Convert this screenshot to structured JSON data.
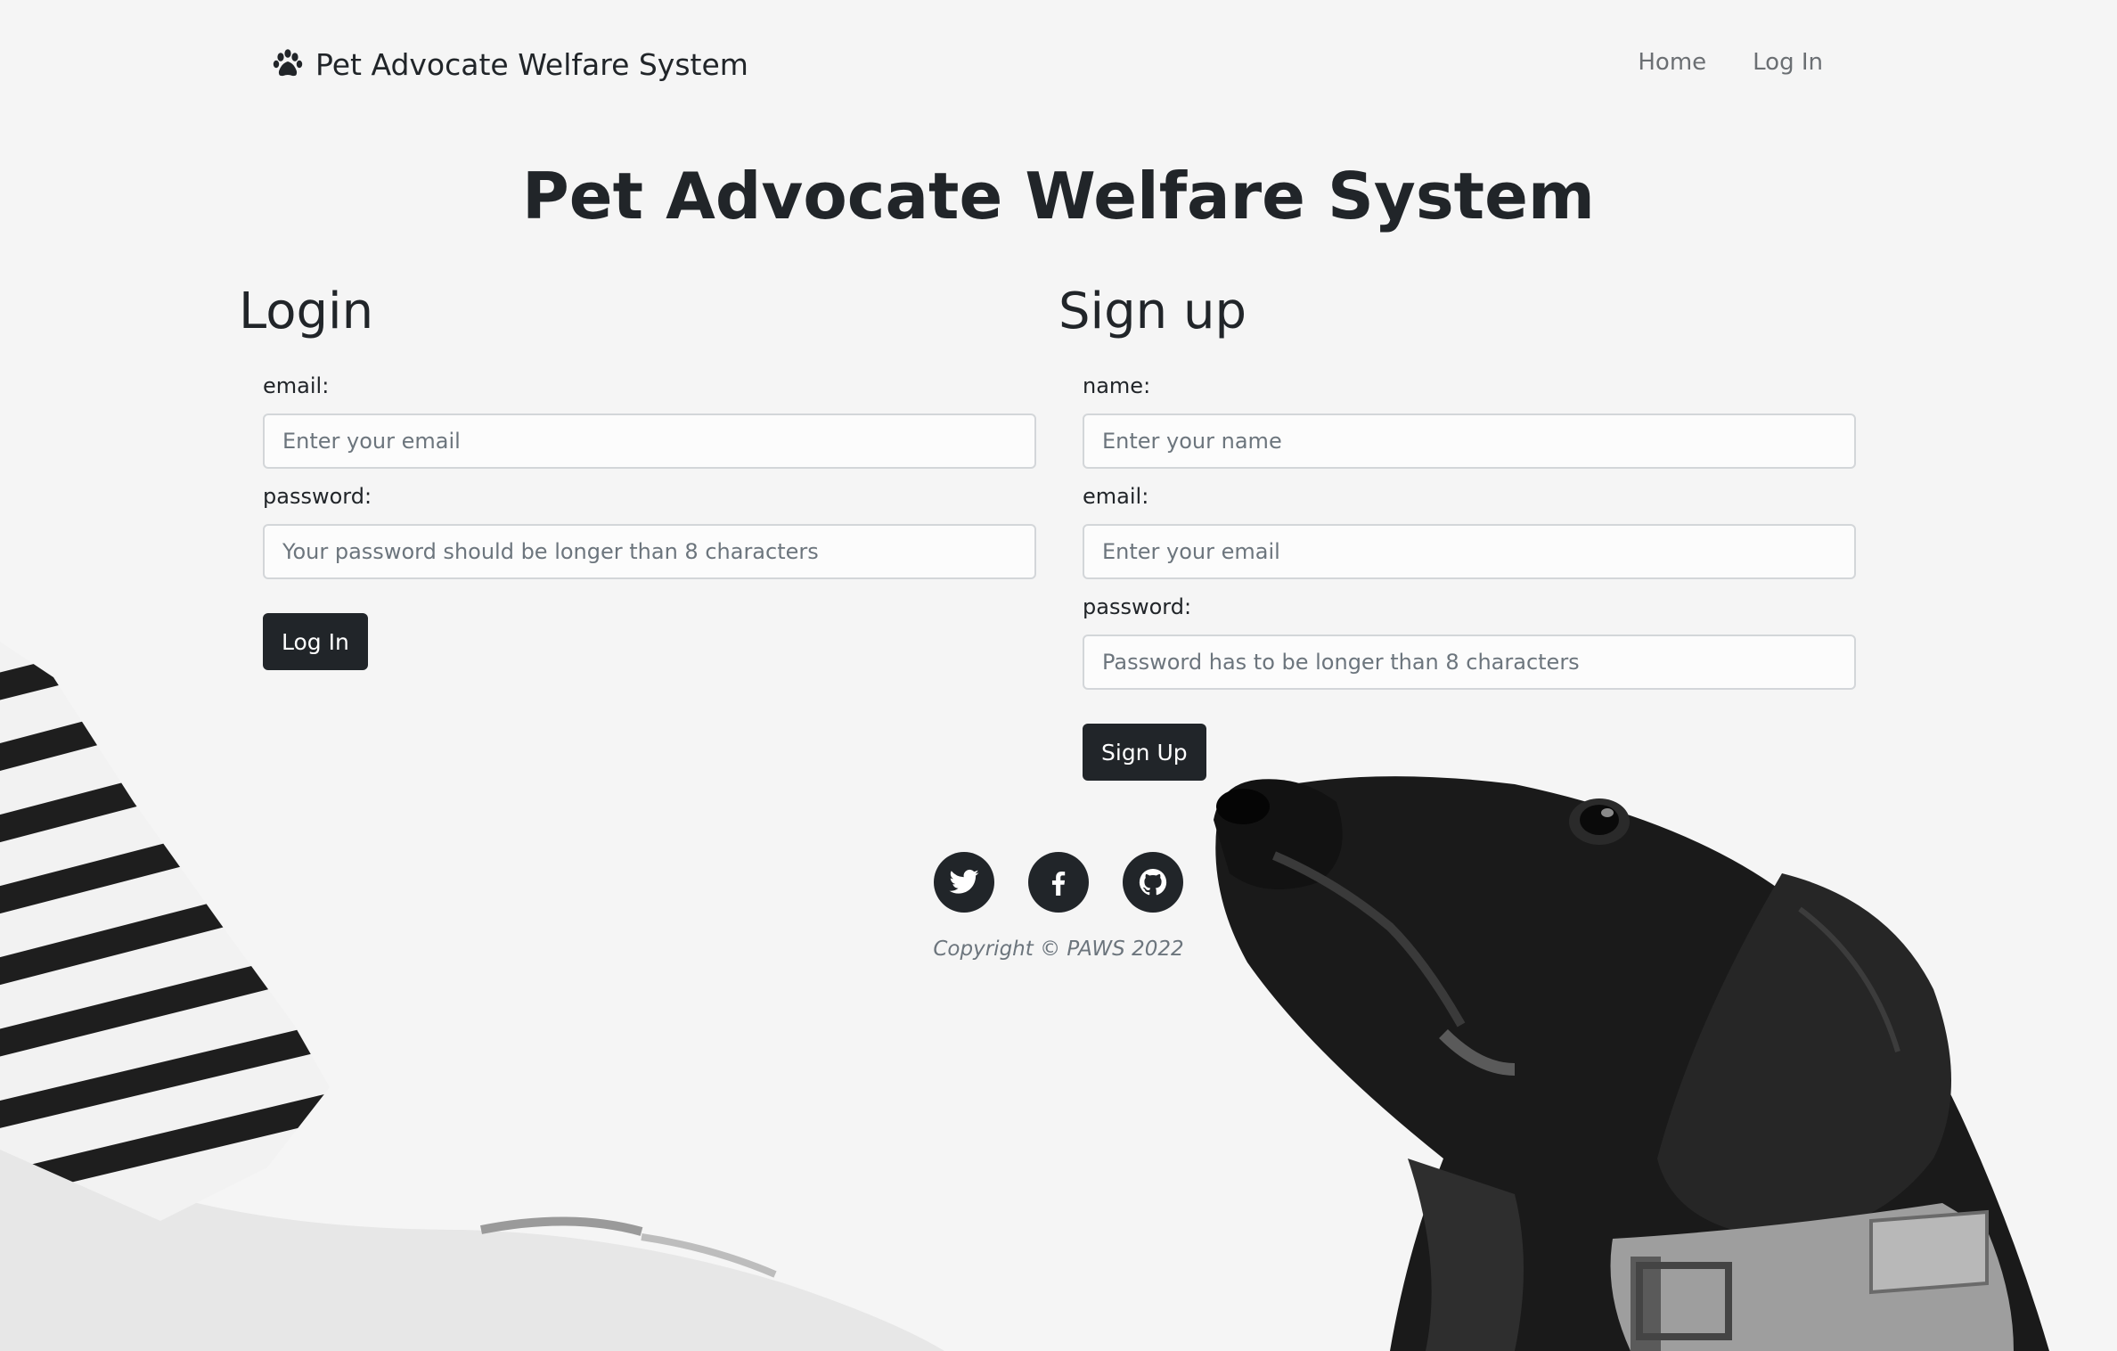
{
  "navbar": {
    "brand": "Pet Advocate Welfare System",
    "links": [
      {
        "label": "Home"
      },
      {
        "label": "Log In"
      }
    ]
  },
  "hero": {
    "title": "Pet Advocate Welfare System"
  },
  "login": {
    "heading": "Login",
    "email_label": "email:",
    "email_placeholder": "Enter your email",
    "password_label": "password:",
    "password_placeholder": "Your password should be longer than 8 characters",
    "submit_label": "Log In"
  },
  "signup": {
    "heading": "Sign up",
    "name_label": "name:",
    "name_placeholder": "Enter your name",
    "email_label": "email:",
    "email_placeholder": "Enter your email",
    "password_label": "password:",
    "password_placeholder": "Password has to be longer than 8 characters",
    "submit_label": "Sign Up"
  },
  "footer": {
    "social": [
      {
        "icon": "twitter-icon"
      },
      {
        "icon": "facebook-icon"
      },
      {
        "icon": "github-icon"
      }
    ],
    "copyright": "Copyright © PAWS 2022"
  },
  "colors": {
    "background": "#f5f5f5",
    "text": "#212529",
    "button": "#212529",
    "muted": "#6c757d"
  }
}
